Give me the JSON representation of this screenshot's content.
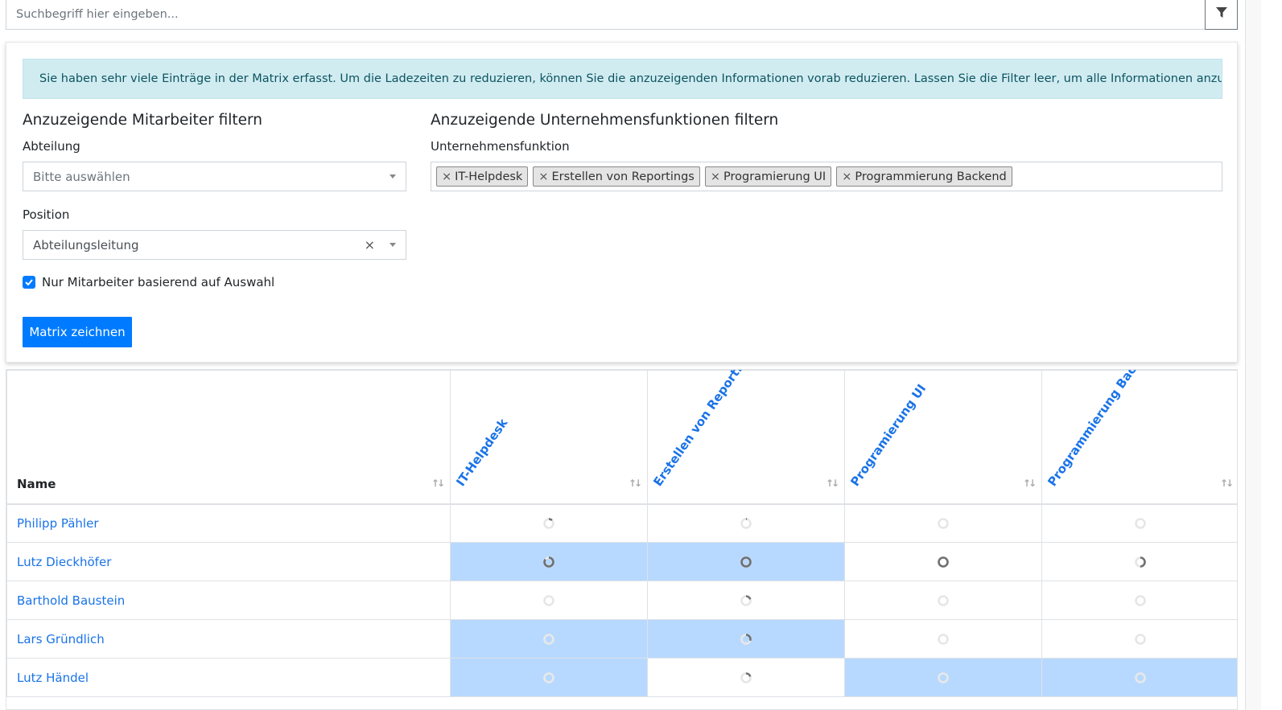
{
  "search": {
    "placeholder": "Suchbegriff hier eingeben...",
    "filter_icon": "filter-icon"
  },
  "info_alert": "Sie haben sehr viele Einträge in der Matrix erfasst. Um die Ladezeiten zu reduzieren, können Sie die anzuzeigenden Informationen vorab reduzieren. Lassen Sie die Filter leer, um alle Informationen anzuzeigen.",
  "filters": {
    "employees_heading": "Anzuzeigende Mitarbeiter filtern",
    "department_label": "Abteilung",
    "department_placeholder": "Bitte auswählen",
    "position_label": "Position",
    "position_value": "Abteilungsleitung",
    "clear_symbol": "×",
    "checkbox_label": "Nur Mitarbeiter basierend auf Auswahl",
    "checkbox_checked": true,
    "functions_heading": "Anzuzeigende Unternehmensfunktionen filtern",
    "functions_label": "Unternehmensfunktion",
    "tag_remove_symbol": "×",
    "functions_tags": [
      "IT-Helpdesk",
      "Erstellen von Reportings",
      "Programierung UI",
      "Programmierung Backend"
    ],
    "draw_button": "Matrix zeichnen"
  },
  "matrix": {
    "name_header": "Name",
    "sort_icon": "↑↓",
    "columns": [
      "IT-Helpdesk",
      "Erstellen von Report...",
      "Programierung UI",
      "Programmierung Backe..."
    ],
    "colors": {
      "highlight": "#b8d9ff",
      "link": "#1a73e8",
      "ring_empty": "#e6e6e6",
      "ring_fill": "#707070"
    },
    "rows": [
      {
        "name": "Philipp Pähler",
        "cells": [
          {
            "fill": 0.12,
            "hl": false
          },
          {
            "fill": 0.03,
            "hl": false
          },
          {
            "fill": 0.0,
            "hl": false
          },
          {
            "fill": 0.0,
            "hl": false
          }
        ]
      },
      {
        "name": "Lutz Dieckhöfer",
        "cells": [
          {
            "fill": 0.85,
            "hl": true
          },
          {
            "fill": 1.0,
            "hl": true
          },
          {
            "fill": 1.0,
            "hl": false
          },
          {
            "fill": 0.5,
            "hl": false
          }
        ]
      },
      {
        "name": "Barthold Baustein",
        "cells": [
          {
            "fill": 0.0,
            "hl": false
          },
          {
            "fill": 0.2,
            "hl": false
          },
          {
            "fill": 0.0,
            "hl": false
          },
          {
            "fill": 0.0,
            "hl": false
          }
        ]
      },
      {
        "name": "Lars Gründlich",
        "cells": [
          {
            "fill": 0.0,
            "hl": true
          },
          {
            "fill": 0.3,
            "hl": true
          },
          {
            "fill": 0.0,
            "hl": false
          },
          {
            "fill": 0.0,
            "hl": false
          }
        ]
      },
      {
        "name": "Lutz Händel",
        "cells": [
          {
            "fill": 0.0,
            "hl": true
          },
          {
            "fill": 0.2,
            "hl": false
          },
          {
            "fill": 0.0,
            "hl": true
          },
          {
            "fill": 0.0,
            "hl": true
          }
        ]
      }
    ]
  }
}
